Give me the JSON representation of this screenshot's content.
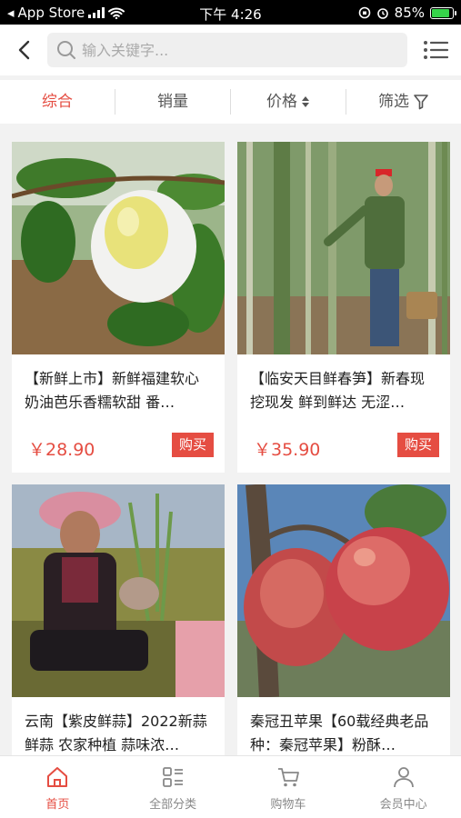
{
  "status_bar": {
    "carrier": "App Store",
    "time": "下午 4:26",
    "battery": "85%"
  },
  "header": {
    "search_placeholder": "输入关键字..."
  },
  "sort_bar": {
    "items": [
      "综合",
      "销量",
      "价格",
      "筛选"
    ]
  },
  "products": [
    {
      "title": "【新鲜上市】新鲜福建软心奶油芭乐香糯软甜 番…",
      "price": "￥28.90",
      "buy_label": "购买"
    },
    {
      "title": "【临安天目鲜春笋】新春现挖现发 鲜到鲜达 无涩…",
      "price": "￥35.90",
      "buy_label": "购买"
    },
    {
      "title": "云南【紫皮鲜蒜】2022新蒜鲜蒜 农家种植 蒜味浓…",
      "price": "",
      "buy_label": ""
    },
    {
      "title": "秦冠丑苹果【60载经典老品种：秦冠苹果】粉酥…",
      "price": "",
      "buy_label": ""
    }
  ],
  "tab_bar": {
    "items": [
      "首页",
      "全部分类",
      "购物车",
      "会员中心"
    ]
  },
  "colors": {
    "accent": "#e54d42",
    "battery": "#36d34a"
  }
}
